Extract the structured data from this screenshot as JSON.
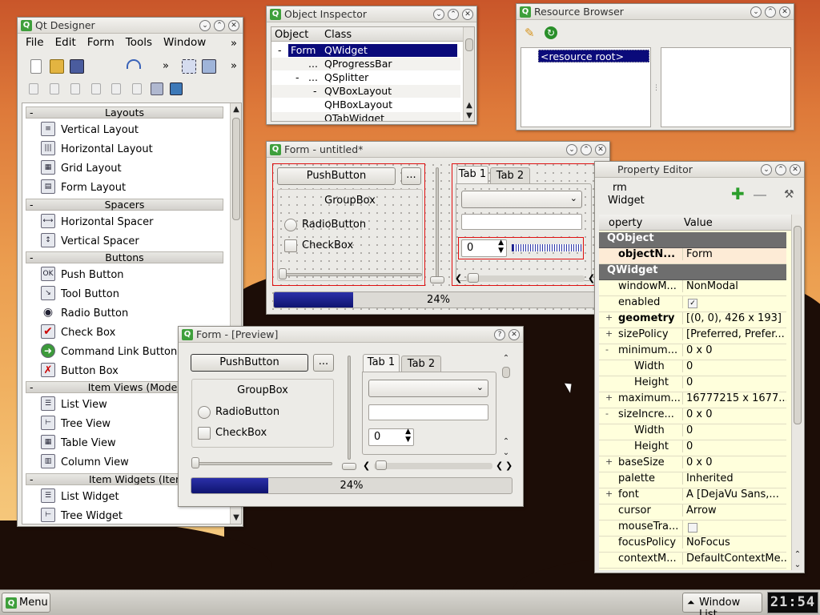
{
  "designer": {
    "title": "Qt Designer",
    "menu": {
      "file": "File",
      "edit": "Edit",
      "form": "Form",
      "tools": "Tools",
      "window": "Window"
    },
    "overflow": "»",
    "widget_box": {
      "layouts": {
        "header": "Layouts",
        "items": [
          "Vertical Layout",
          "Horizontal Layout",
          "Grid Layout",
          "Form Layout"
        ]
      },
      "spacers": {
        "header": "Spacers",
        "items": [
          "Horizontal Spacer",
          "Vertical Spacer"
        ]
      },
      "buttons": {
        "header": "Buttons",
        "items": [
          "Push Button",
          "Tool Button",
          "Radio Button",
          "Check Box",
          "Command Link Button",
          "Button Box"
        ]
      },
      "item_views": {
        "header": "Item Views (Model-Base",
        "items": [
          "List View",
          "Tree View",
          "Table View",
          "Column View"
        ]
      },
      "item_widgets": {
        "header": "Item Widgets (Item-Bas",
        "items": [
          "List Widget",
          "Tree Widget"
        ]
      }
    },
    "icon_labels": {
      "ok": "OK"
    }
  },
  "object_inspector": {
    "title": "Object Inspector",
    "col_object": "Object",
    "col_class": "Class",
    "rows": [
      {
        "object": "Form",
        "class": "QWidget"
      },
      {
        "object": "...",
        "class": "QProgressBar"
      },
      {
        "object": "...",
        "class": "QSplitter"
      },
      {
        "object": "",
        "class": "QVBoxLayout"
      },
      {
        "object": "",
        "class": "QHBoxLayout"
      },
      {
        "object": "",
        "class": "QTabWidget"
      }
    ]
  },
  "resource_browser": {
    "title": "Resource Browser",
    "root": "<resource root>"
  },
  "form": {
    "title": "Form - untitled*",
    "push": "PushButton",
    "tool": "...",
    "group": "GroupBox",
    "radio": "RadioButton",
    "check": "CheckBox",
    "tab1": "Tab 1",
    "tab2": "Tab 2",
    "spin": "0",
    "progress_text": "24%",
    "progress": 0.24
  },
  "preview": {
    "title": "Form - [Preview]",
    "help": "?",
    "push": "PushButton",
    "tool": "...",
    "group": "GroupBox",
    "radio": "RadioButton",
    "check": "CheckBox",
    "tab1": "Tab 1",
    "tab2": "Tab 2",
    "spin": "0",
    "progress_text": "24%",
    "progress": 0.24
  },
  "property_editor": {
    "title": "Property Editor",
    "obj_name": "rm",
    "obj_class": "Widget",
    "col_property": "operty",
    "col_value": "Value",
    "sections": {
      "qobject": "QObject",
      "qwidget": "QWidget"
    },
    "rows": [
      {
        "name": "objectN...",
        "value": "Form",
        "bold": true
      },
      {
        "name": "windowM...",
        "value": "NonModal"
      },
      {
        "name": "enabled",
        "value": "✓"
      },
      {
        "name": "geometry",
        "value": "[(0, 0), 426 x 193]",
        "bold": true,
        "exp": "+"
      },
      {
        "name": "sizePolicy",
        "value": "[Preferred, Prefer...",
        "exp": "+"
      },
      {
        "name": "minimum...",
        "value": "0 x 0",
        "exp": "-"
      },
      {
        "name": "Width",
        "value": "0",
        "sub": true
      },
      {
        "name": "Height",
        "value": "0",
        "sub": true
      },
      {
        "name": "maximum...",
        "value": "16777215 x 1677...",
        "exp": "+"
      },
      {
        "name": "sizeIncre...",
        "value": "0 x 0",
        "exp": "-"
      },
      {
        "name": "Width",
        "value": "0",
        "sub": true
      },
      {
        "name": "Height",
        "value": "0",
        "sub": true
      },
      {
        "name": "baseSize",
        "value": "0 x 0",
        "exp": "+"
      },
      {
        "name": "palette",
        "value": "Inherited"
      },
      {
        "name": "font",
        "value": "A  [DejaVu Sans,...",
        "exp": "+"
      },
      {
        "name": "cursor",
        "value": "Arrow"
      },
      {
        "name": "mouseTra...",
        "value": ""
      },
      {
        "name": "focusPolicy",
        "value": "NoFocus"
      },
      {
        "name": "contextM...",
        "value": "DefaultContextMe..."
      }
    ]
  },
  "taskbar": {
    "menu": "Menu",
    "window_list": "Window List",
    "clock": "21:54"
  },
  "colors": {
    "selection": "#0a0a7a",
    "qt_green": "#3e9f3b",
    "progress": "#1a1f8a",
    "property_bg": "#ffffdc"
  }
}
